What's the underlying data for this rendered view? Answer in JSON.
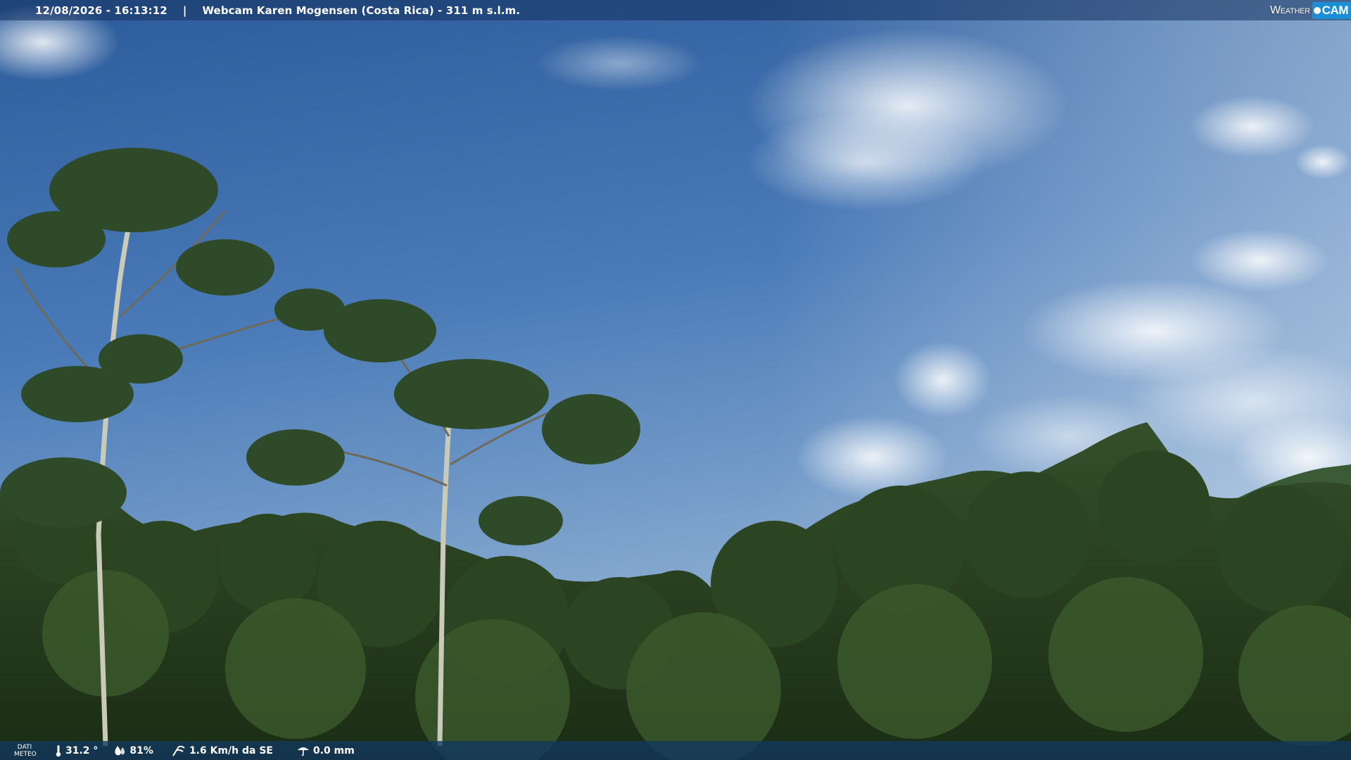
{
  "overlay": {
    "timestamp": "12/08/2026 - 16:13:12",
    "separator": "|",
    "title": "Webcam Karen Mogensen (Costa Rica) - 311 m s.l.m."
  },
  "brand": {
    "weather": "Weather",
    "cam": "CAM",
    "accent": "#1a8fd6"
  },
  "meteo": {
    "label_line1": "DATI",
    "label_line2": "METEO",
    "temperature": "31.2 °",
    "humidity": "81%",
    "wind": "1.6 Km/h da SE",
    "rain": "0.0 mm",
    "icons": [
      "thermometer-icon",
      "humidity-drop-icon",
      "wind-icon",
      "rain-icon"
    ]
  },
  "scene": {
    "sky_top": "#2f5f9e",
    "sky_bottom": "#8fb3d6",
    "foliage_dark": "#1e3216",
    "foliage_mid": "#2f4a22"
  }
}
